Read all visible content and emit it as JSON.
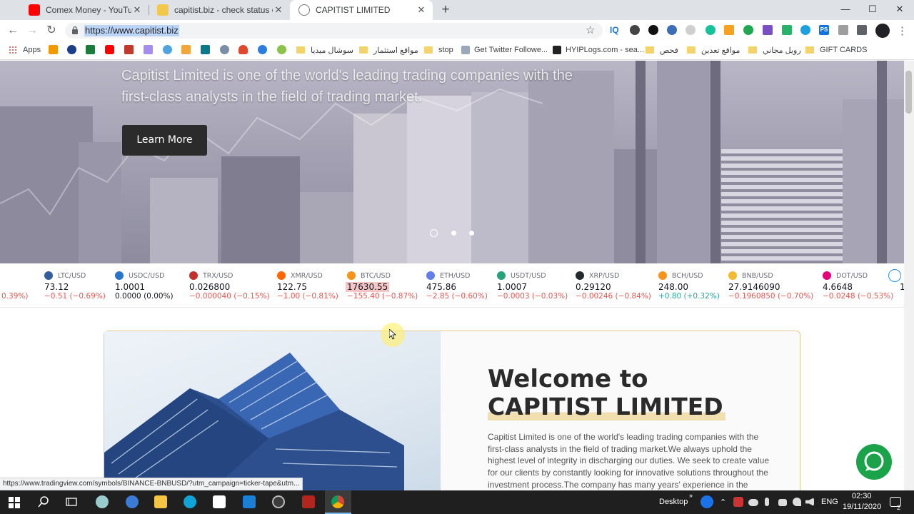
{
  "browser": {
    "tabs": [
      {
        "title": "Comex Money - YouTube",
        "favicon_color": "#ff0000"
      },
      {
        "title": "capitist.biz - check status on HYIP",
        "favicon_color": "#f2c84b"
      },
      {
        "title": "CAPITIST LIMITED",
        "favicon_color": "#8a8a8a"
      }
    ],
    "url": "https://www.capitist.biz",
    "extensions": {
      "iq_label": "IQ",
      "badge": "0",
      "ps_label": "PS"
    },
    "window_controls": {
      "minimize": "—",
      "maximize": "☐",
      "close": "✕"
    }
  },
  "bookmarks": {
    "apps_label": "Apps",
    "items": [
      {
        "label": "سوشال ميديا"
      },
      {
        "label": "مواقع استثمار"
      },
      {
        "label": "stop"
      },
      {
        "label": "Get Twitter Followe..."
      },
      {
        "label": "HYIPLogs.com - sea..."
      },
      {
        "label": "فحص"
      },
      {
        "label": "مواقع تعدين"
      },
      {
        "label": "رويل مجاني"
      },
      {
        "label": "GIFT CARDS"
      }
    ]
  },
  "hero": {
    "text": "Capitist Limited is one of the world's leading trading companies with the first-class analysts in the field of trading market.",
    "button_label": "Learn More",
    "slides": 3,
    "active_slide": 1
  },
  "ticker": {
    "leading_change": "0.39%)",
    "items": [
      {
        "symbol": "LTC/USD",
        "price": "73.12",
        "change": "−0.51 (−0.69%)",
        "trend": "neg",
        "color": "#345d9d"
      },
      {
        "symbol": "USDC/USD",
        "price": "1.0001",
        "change": "0.0000 (0.00%)",
        "trend": "flat",
        "color": "#2775ca"
      },
      {
        "symbol": "TRX/USD",
        "price": "0.026800",
        "change": "−0.000040 (−0.15%)",
        "trend": "neg",
        "color": "#c4302b"
      },
      {
        "symbol": "XMR/USD",
        "price": "122.75",
        "change": "−1.00 (−0.81%)",
        "trend": "neg",
        "color": "#ff6600"
      },
      {
        "symbol": "BTC/USD",
        "price": "17630.55",
        "change": "−155.40 (−0.87%)",
        "trend": "neg",
        "color": "#f7931a",
        "highlight": true
      },
      {
        "symbol": "ETH/USD",
        "price": "475.86",
        "change": "−2.85 (−0.60%)",
        "trend": "neg",
        "color": "#627eea"
      },
      {
        "symbol": "USDT/USD",
        "price": "1.0007",
        "change": "−0.0003 (−0.03%)",
        "trend": "neg",
        "color": "#26a17b"
      },
      {
        "symbol": "XRP/USD",
        "price": "0.29120",
        "change": "−0.00246 (−0.84%)",
        "trend": "neg",
        "color": "#23292f"
      },
      {
        "symbol": "BCH/USD",
        "price": "248.00",
        "change": "+0.80 (+0.32%)",
        "trend": "pos",
        "color": "#f7931a"
      },
      {
        "symbol": "BNB/USD",
        "price": "27.9146090",
        "change": "−0.1960850 (−0.70%)",
        "trend": "neg",
        "color": "#f3ba2f"
      },
      {
        "symbol": "DOT/USD",
        "price": "4.6648",
        "change": "−0.0248 (−0.53%)",
        "trend": "neg",
        "color": "#e6007a"
      }
    ],
    "trailing_price": "1"
  },
  "welcome": {
    "line1": "Welcome to",
    "line2": "CAPITIST LIMITED",
    "body": "Capitist Limited is one of the world's leading trading companies with the first-class analysts in the field of trading market.We always uphold the highest level of integrity in discharging our duties. We seek to create value for our clients by constantly looking for innovative solutions throughout the investment process.The company has many years' experience in the trading"
  },
  "status_url": "https://www.tradingview.com/symbols/BINANCE-BNBUSD/?utm_campaign=ticker-tape&utm...",
  "taskbar": {
    "desktop_label": "Desktop",
    "lang": "ENG",
    "time": "02:30",
    "date": "19/11/2020",
    "notification_count": "2"
  },
  "colors": {
    "accent_gold": "#e7c98f",
    "chat_green": "#1ba34a",
    "button_dark": "#2b2b2b"
  }
}
